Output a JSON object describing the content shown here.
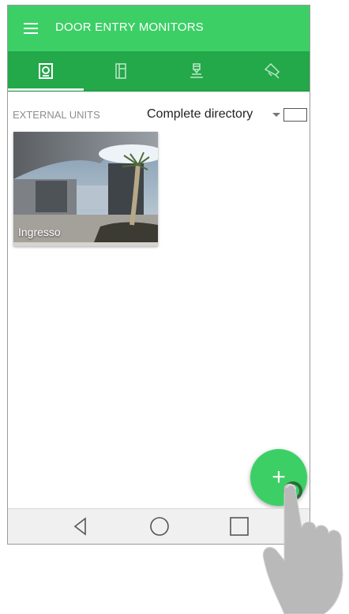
{
  "app": {
    "title": "DOOR ENTRY MONITORS"
  },
  "tabs": [
    {
      "icon": "door-panel-icon",
      "selected": true
    },
    {
      "icon": "intercom-icon",
      "selected": false
    },
    {
      "icon": "concierge-icon",
      "selected": false
    },
    {
      "icon": "actuator-icon",
      "selected": false
    }
  ],
  "section": {
    "label": "EXTERNAL UNITS",
    "directory": "Complete directory"
  },
  "units": [
    {
      "name": "Ingresso"
    }
  ],
  "fab": {
    "symbol": "+"
  },
  "colors": {
    "appbar": "#3ccf66",
    "tabbar": "#23a84a",
    "fab": "#3ccf66"
  },
  "navigation": [
    "back-icon",
    "home-icon",
    "recents-icon"
  ]
}
